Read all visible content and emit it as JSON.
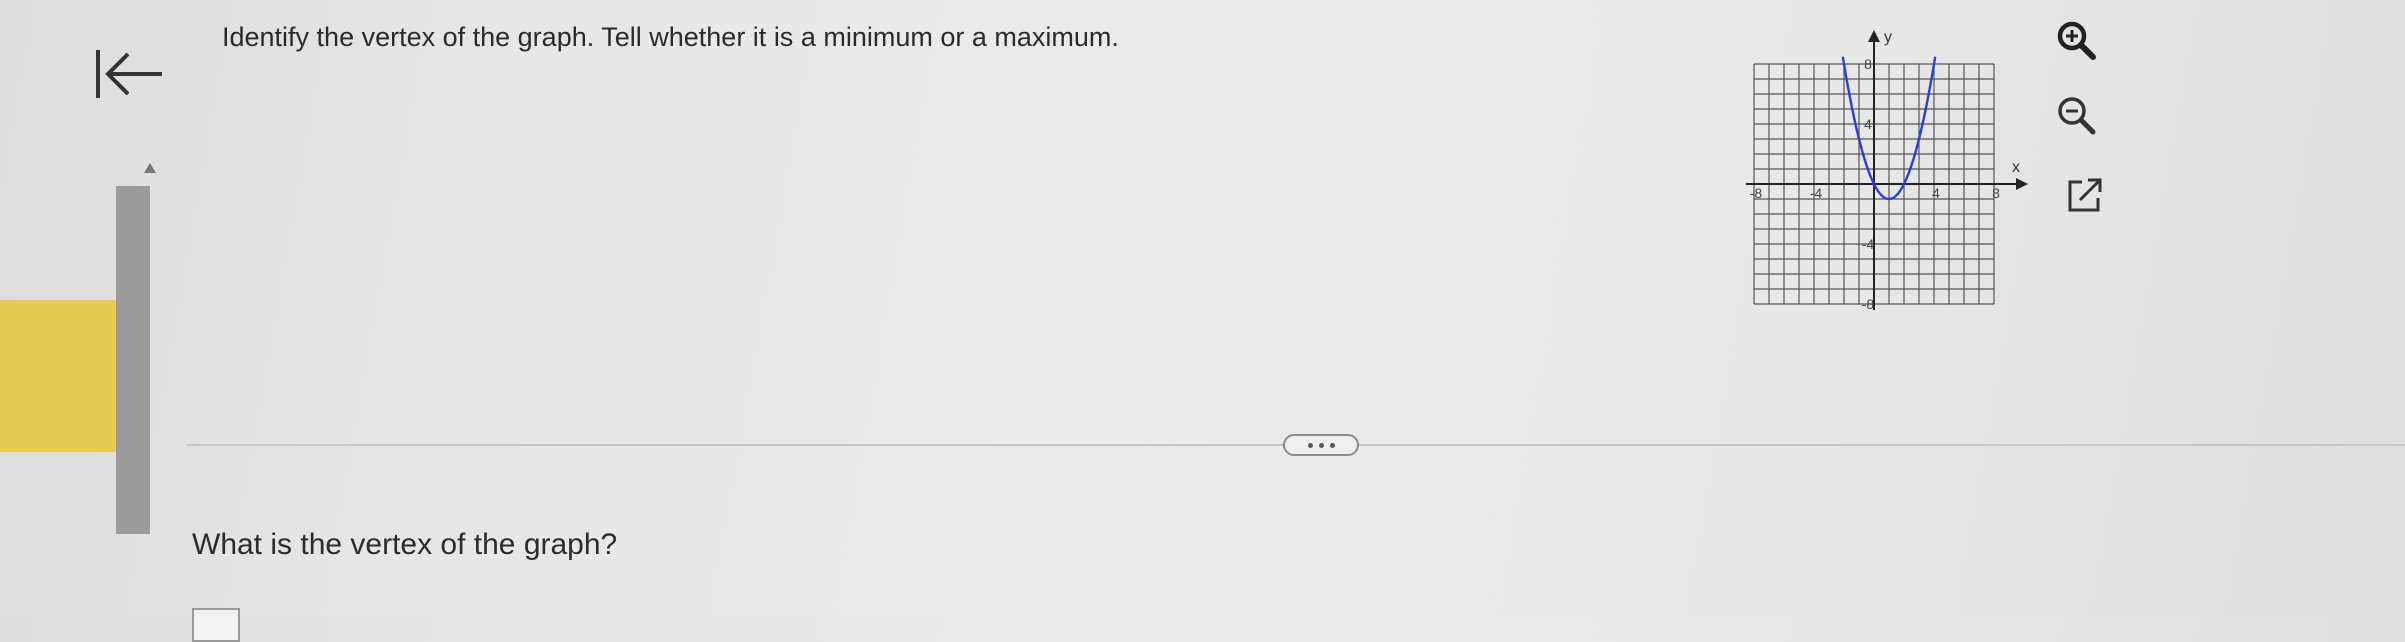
{
  "question": {
    "prompt": "Identify the vertex of the graph. Tell whether it is a minimum or a maximum.",
    "sub_prompt": "What is the vertex of the graph?"
  },
  "graph": {
    "x_axis_label": "x",
    "y_axis_label": "y",
    "x_ticks": [
      "-8",
      "-4",
      "4",
      "8"
    ],
    "y_ticks": [
      "8",
      "4",
      "-4",
      "-8"
    ],
    "grid_range": {
      "x": [
        -8,
        8
      ],
      "y": [
        -8,
        8
      ]
    },
    "curve": {
      "type": "parabola",
      "vertex": [
        1,
        -1
      ],
      "opens": "up",
      "a": 1
    },
    "curve_color": "#2b3fd6"
  },
  "tools": {
    "zoom_in": "zoom-in-icon",
    "zoom_out": "zoom-out-icon",
    "popout": "external-link-icon"
  },
  "colors": {
    "accent_tab": "#e6cb55",
    "scrollbar": "#a5a5a5"
  }
}
